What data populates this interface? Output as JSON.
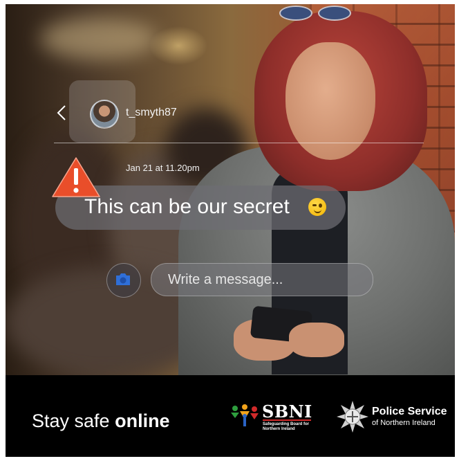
{
  "chat": {
    "username": "t_smyth87",
    "timestamp": "Jan 21 at 11.20pm",
    "message": "This can be our secret",
    "message_emoji": "winking-face-icon",
    "input_placeholder": "Write a message..."
  },
  "banner": {
    "slogan_regular": "Stay safe ",
    "slogan_bold": "online",
    "sbni_name": "SBNI",
    "sbni_subtitle": "Safeguarding Board for Northern Ireland",
    "psni_title": "Police Service",
    "psni_subtitle": "of Northern Ireland"
  },
  "colors": {
    "warning": "#e94e2a",
    "banner_bg": "#000000",
    "camera_icon": "#2f6fd8"
  }
}
